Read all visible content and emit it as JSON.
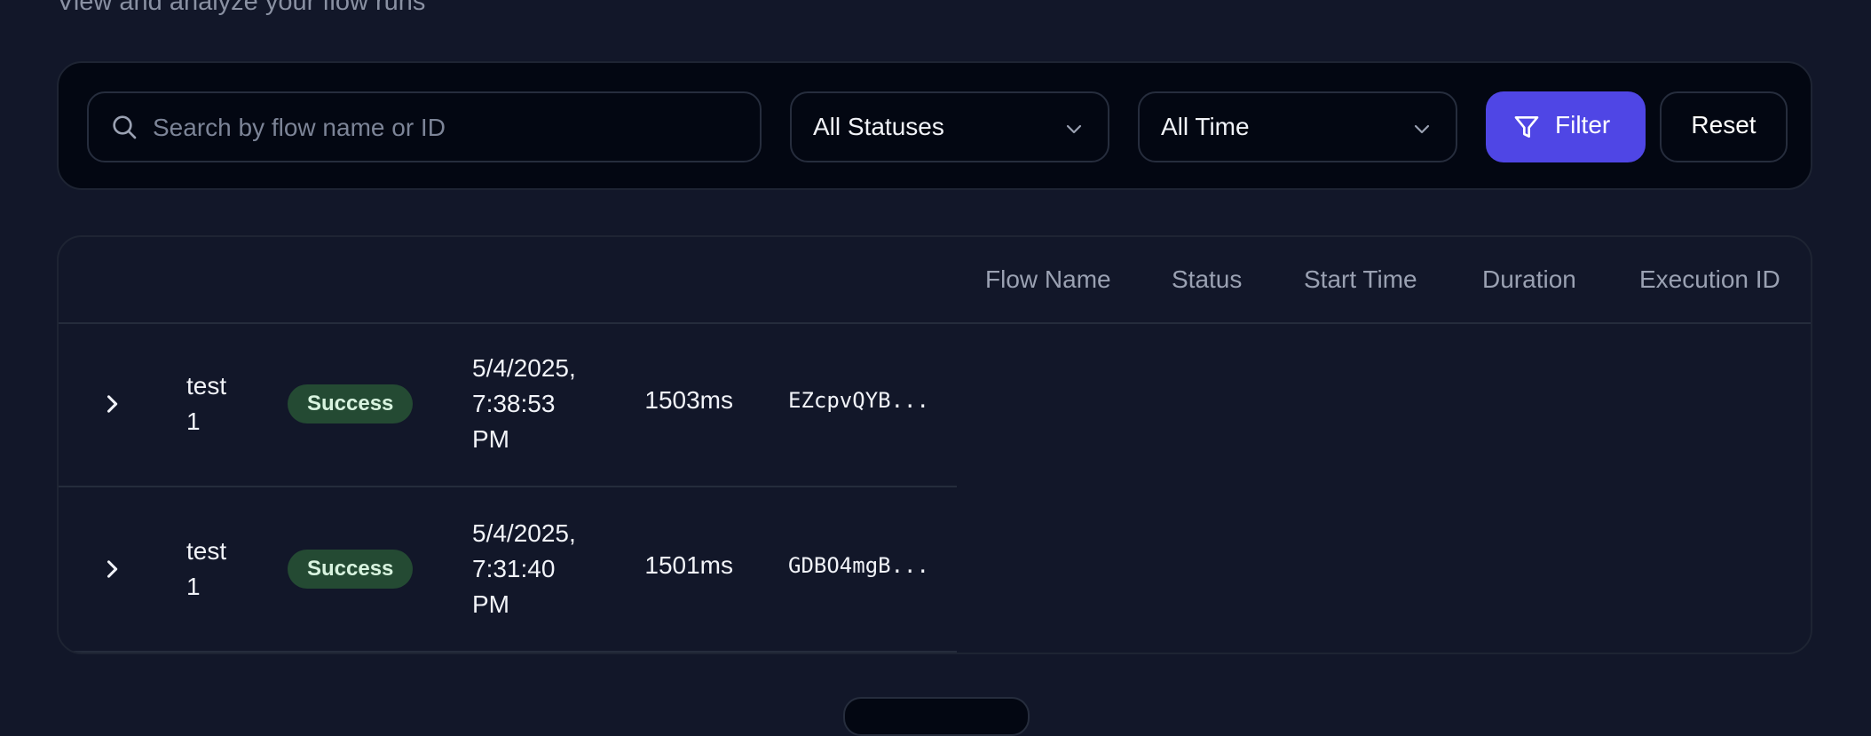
{
  "header": {
    "subtitle": "View and analyze your flow runs"
  },
  "filters": {
    "search_placeholder": "Search by flow name or ID",
    "status_select": "All Statuses",
    "time_select": "All Time",
    "filter_label": "Filter",
    "reset_label": "Reset",
    "accent_color": "#4f46e5"
  },
  "table": {
    "columns": [
      "Flow Name",
      "Status",
      "Start Time",
      "Duration",
      "Execution ID"
    ],
    "rows": [
      {
        "flow_name": "test 1",
        "status": "Success",
        "start_time": "5/4/2025, 7:38:53 PM",
        "duration": "1503ms",
        "execution_id": "EZcpvQYB..."
      },
      {
        "flow_name": "test 1",
        "status": "Success",
        "start_time": "5/4/2025, 7:31:40 PM",
        "duration": "1501ms",
        "execution_id": "GDBO4mgB..."
      }
    ],
    "status_color": "#244a33"
  }
}
